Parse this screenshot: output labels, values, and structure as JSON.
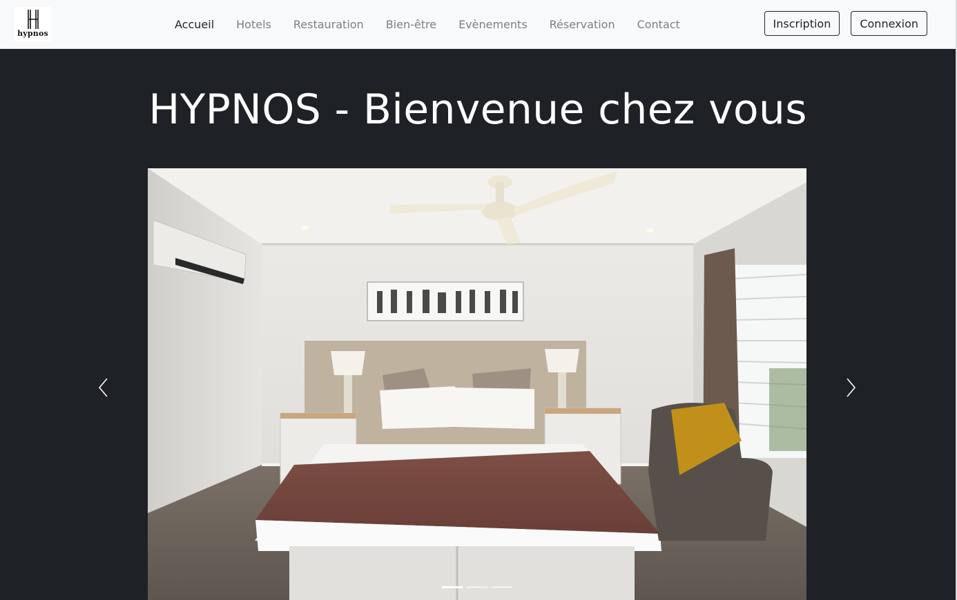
{
  "brand": {
    "logo_letter": "H",
    "name": "hypnos"
  },
  "nav": {
    "items": [
      {
        "label": "Accueil",
        "active": true
      },
      {
        "label": "Hotels",
        "active": false
      },
      {
        "label": "Restauration",
        "active": false
      },
      {
        "label": "Bien-être",
        "active": false
      },
      {
        "label": "Evènements",
        "active": false
      },
      {
        "label": "Réservation",
        "active": false
      },
      {
        "label": "Contact",
        "active": false
      }
    ]
  },
  "auth": {
    "signup_label": "Inscription",
    "login_label": "Connexion"
  },
  "hero": {
    "title": "HYPNOS - Bienvenue chez vous"
  },
  "carousel": {
    "slide_count": 3,
    "active_index": 0,
    "prev_icon": "chevron-left-icon",
    "next_icon": "chevron-right-icon"
  },
  "colors": {
    "page_background": "#1e2125",
    "navbar_background": "#f8f9fa",
    "nav_text": "#7b7f84",
    "nav_active_text": "#212529",
    "title_text": "#ffffff"
  }
}
